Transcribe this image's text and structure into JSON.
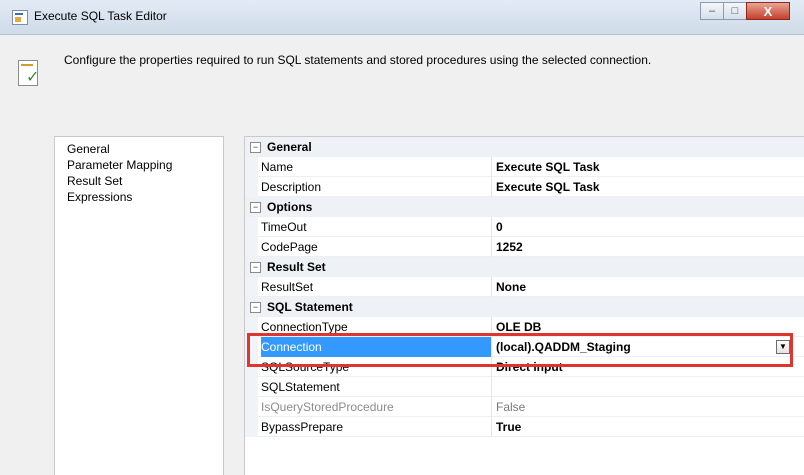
{
  "window": {
    "title": "Execute SQL Task Editor",
    "minimize_glyph": "–",
    "maximize_glyph": "□",
    "close_glyph": "X"
  },
  "header": {
    "description": "Configure the properties required to run SQL statements and stored procedures using the selected connection."
  },
  "nav": {
    "items": [
      "General",
      "Parameter Mapping",
      "Result Set",
      "Expressions"
    ]
  },
  "grid": {
    "general": {
      "title": "General",
      "name_label": "Name",
      "name_value": "Execute SQL Task",
      "description_label": "Description",
      "description_value": "Execute SQL Task"
    },
    "options": {
      "title": "Options",
      "timeout_label": "TimeOut",
      "timeout_value": "0",
      "codepage_label": "CodePage",
      "codepage_value": "1252"
    },
    "result_set": {
      "title": "Result Set",
      "resultset_label": "ResultSet",
      "resultset_value": "None"
    },
    "sql_statement": {
      "title": "SQL Statement",
      "connectiontype_label": "ConnectionType",
      "connectiontype_value": "OLE DB",
      "connection_label": "Connection",
      "connection_value": "(local).QADDM_Staging",
      "sqlsourcetype_label": "SQLSourceType",
      "sqlsourcetype_value": "Direct input",
      "sqlstatement_label": "SQLStatement",
      "sqlstatement_value": "",
      "isquerystoredprocedure_label": "IsQueryStoredProcedure",
      "isquerystoredprocedure_value": "False",
      "bypassprepare_label": "BypassPrepare",
      "bypassprepare_value": "True"
    },
    "toggle_glyph": "−"
  },
  "colors": {
    "selection": "#3399ff",
    "highlight_box": "#e0342f"
  }
}
